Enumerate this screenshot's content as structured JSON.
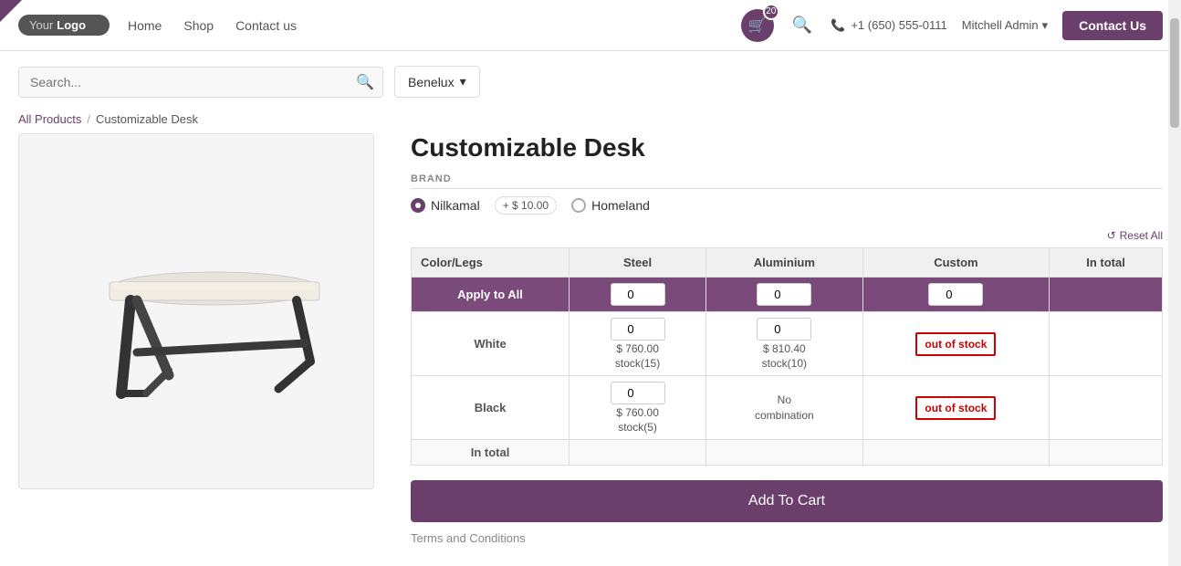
{
  "brand_name": "YourLogo",
  "nav": {
    "home": "Home",
    "shop": "Shop",
    "contact_us_nav": "Contact us",
    "phone": "+1 (650) 555-0111",
    "user": "Mitchell Admin",
    "contact_btn": "Contact Us",
    "cart_count": "20"
  },
  "search": {
    "placeholder": "Search...",
    "region": "Benelux"
  },
  "breadcrumb": {
    "all_products": "All Products",
    "separator": "/",
    "current": "Customizable Desk"
  },
  "product": {
    "title": "Customizable Desk",
    "brand_label": "BRAND",
    "brands": [
      {
        "name": "Nilkamal",
        "selected": true,
        "price_modifier": "+ $ 10.00"
      },
      {
        "name": "Homeland",
        "selected": false
      }
    ],
    "reset_all": "Reset All",
    "table": {
      "headers": [
        "Color/Legs",
        "Steel",
        "Aluminium",
        "Custom",
        "In total"
      ],
      "apply_to_all": {
        "label": "Apply to All",
        "steel_qty": "0",
        "aluminium_qty": "0",
        "custom_qty": "0"
      },
      "rows": [
        {
          "color": "White",
          "steel": {
            "qty": "0",
            "price": "$ 760.00",
            "stock": "stock(15)"
          },
          "aluminium": {
            "qty": "0",
            "price": "$ 810.40",
            "stock": "stock(10)"
          },
          "custom": "out of stock",
          "in_total": ""
        },
        {
          "color": "Black",
          "steel": {
            "qty": "0",
            "price": "$ 760.00",
            "stock": "stock(5)"
          },
          "aluminium": "No combination",
          "custom": "out of stock",
          "in_total": ""
        }
      ],
      "in_total_label": "In total"
    },
    "add_to_cart": "Add To Cart",
    "terms": "Terms and Conditions"
  }
}
